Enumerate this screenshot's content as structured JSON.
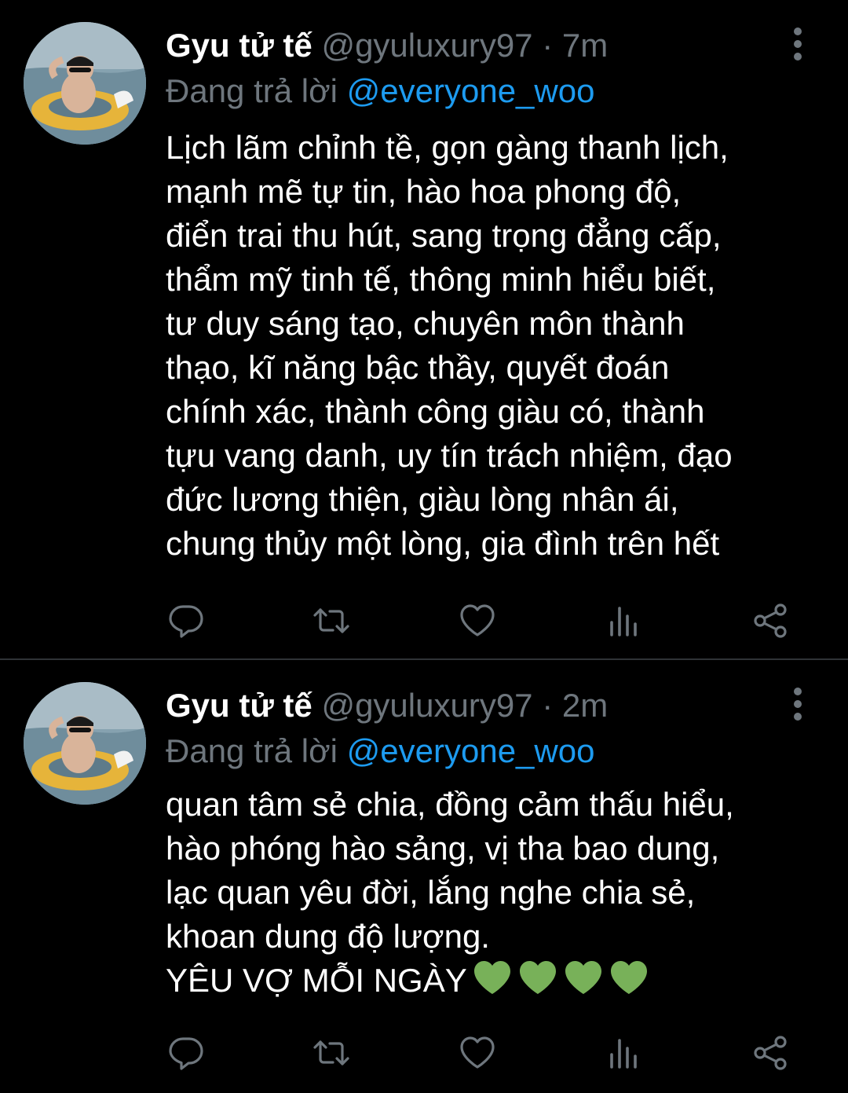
{
  "tweets": [
    {
      "author_name": "Gyu tử tế",
      "handle": "@gyuluxury97",
      "separator": "·",
      "time": "7m",
      "reply_prefix": "Đang trả lời",
      "reply_to": "@everyone_woo",
      "text": "Lịch lãm chỉnh tề, gọn gàng thanh lịch,\nmạnh mẽ tự tin, hào hoa phong độ,\nđiển trai thu hút, sang trọng đẳng cấp,\nthẩm mỹ tinh tế, thông minh hiểu biết,\ntư duy sáng tạo, chuyên môn thành\nthạo, kĩ năng bậc thầy, quyết đoán\nchính xác, thành công giàu có, thành\ntựu vang danh, uy tín trách nhiệm, đạo\nđức lương thiện, giàu lòng nhân ái,\nchung thủy một lòng, gia đình trên hết"
    },
    {
      "author_name": "Gyu tử tế",
      "handle": "@gyuluxury97",
      "separator": "·",
      "time": "2m",
      "reply_prefix": "Đang trả lời",
      "reply_to": "@everyone_woo",
      "text": "quan tâm sẻ chia, đồng cảm thấu hiểu,\nhào phóng hào sảng, vị tha bao dung,\nlạc quan yêu đời, lắng nghe chia sẻ,\nkhoan dung độ lượng.\nYÊU VỢ MỖI NGÀY",
      "emoji": [
        "green-heart",
        "green-heart",
        "green-heart",
        "green-heart"
      ]
    }
  ],
  "icons": {
    "reply": "reply-icon",
    "retweet": "retweet-icon",
    "like": "heart-icon",
    "views": "analytics-icon",
    "share": "share-icon",
    "more": "more-vertical-icon"
  },
  "colors": {
    "background": "#000000",
    "text": "#ffffff",
    "secondary": "#6e767d",
    "mention": "#1d9bf0",
    "divider": "#2f3336",
    "heart_emoji": "#78b159"
  }
}
